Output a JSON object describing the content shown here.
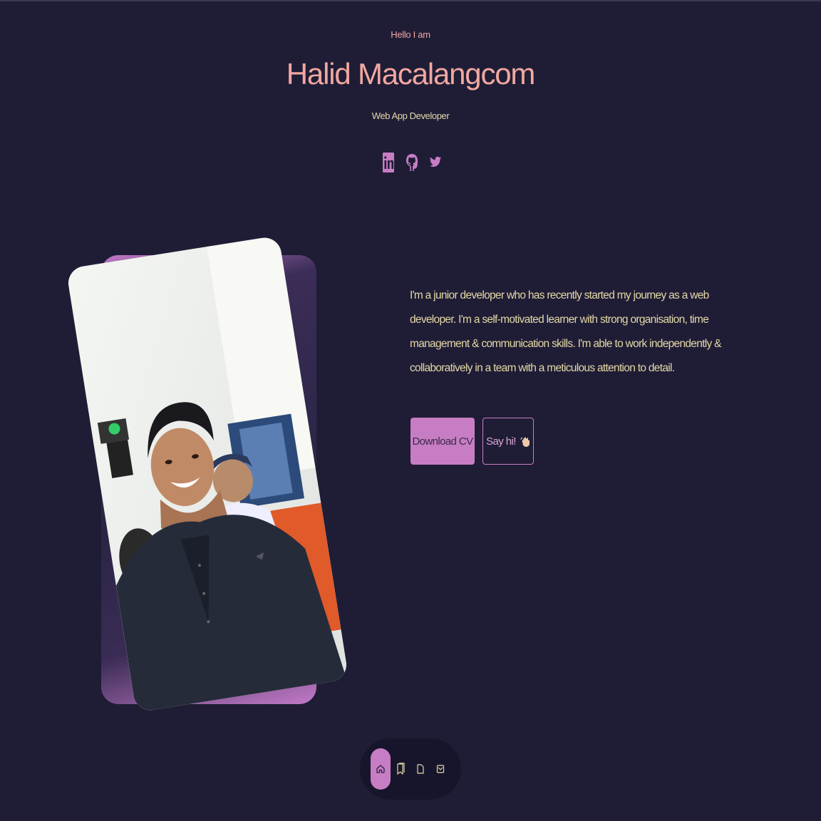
{
  "hero": {
    "greeting": "Hello I am",
    "name": "Halid Macalangcom",
    "role": "Web App Developer"
  },
  "socials": [
    {
      "icon": "linkedin-icon"
    },
    {
      "icon": "github-icon"
    },
    {
      "icon": "twitter-icon"
    }
  ],
  "about": {
    "text": "I'm a junior developer who has recently started my journey as a web developer. I'm a self-motivated learner with strong organisation, time management & communication skills. I'm able to work independently & collaboratively in a team with a meticulous attention to detail."
  },
  "buttons": {
    "download_cv": "Download CV",
    "say_hi": "Say hi!"
  },
  "dock": {
    "items": [
      {
        "icon": "home-icon",
        "active": true
      },
      {
        "icon": "bookmark-icon",
        "active": false
      },
      {
        "icon": "document-icon",
        "active": false
      },
      {
        "icon": "mail-icon",
        "active": false
      }
    ]
  },
  "colors": {
    "background": "#1f1d36",
    "accent": "#c77dc4",
    "name": "#f2a7a0",
    "text": "#e4d8a6"
  }
}
